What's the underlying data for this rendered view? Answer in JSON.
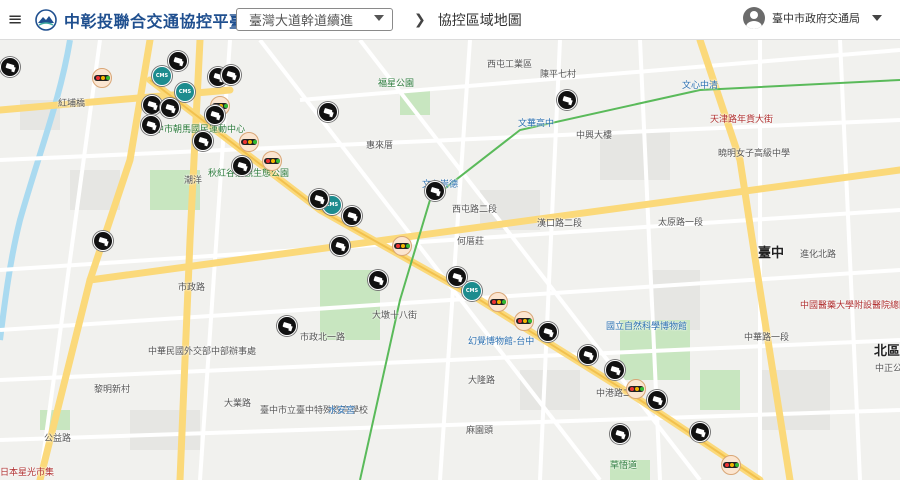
{
  "header": {
    "app_title": "中彰投聯合交通協控平臺",
    "route_select": "臺灣大道幹道續進",
    "breadcrumb": "協控區域地圖",
    "user_name": "臺中市政府交通局"
  },
  "icons": {
    "menu": "hamburger-icon",
    "logo": "mountain-logo",
    "user": "account-circle-icon",
    "chevron": "chevron-right-icon"
  },
  "marker_types": {
    "cam": "cctv-camera-icon",
    "tl": "traffic-signal-icon",
    "cms": "cms-sign-icon"
  },
  "marker_legend": {
    "cms_text": "CMS"
  },
  "colors": {
    "header_title": "#1f4f8f",
    "cms": "#1d8c8e",
    "camera": "#111111",
    "signal_bg": "#fbe5d0"
  },
  "map_labels": [
    {
      "text": "西屯工業區"
    },
    {
      "text": "陳平七村"
    },
    {
      "text": "福星公園"
    },
    {
      "text": "文華高中"
    },
    {
      "text": "惠來厝"
    },
    {
      "text": "文心崇德"
    },
    {
      "text": "天津路年貨大街"
    },
    {
      "text": "曉明女子高級中學"
    },
    {
      "text": "臺中市朝馬國民運動中心"
    },
    {
      "text": "秋紅谷景觀生態公園"
    },
    {
      "text": "潮洋"
    },
    {
      "text": "西屯路二段"
    },
    {
      "text": "何厝莊"
    },
    {
      "text": "漢口路二段"
    },
    {
      "text": "太原路一段"
    },
    {
      "text": "臺中"
    },
    {
      "text": "中國醫藥大學附設醫院總院"
    },
    {
      "text": "國立自然科學博物館"
    },
    {
      "text": "幻覺博物館-台中"
    },
    {
      "text": "中華民國外交部中部辦事處"
    },
    {
      "text": "黎明新村"
    },
    {
      "text": "臺中市立臺中特殊教育學校"
    },
    {
      "text": "水安宮"
    },
    {
      "text": "麻園頭"
    },
    {
      "text": "草悟道"
    },
    {
      "text": "日本星光市集"
    },
    {
      "text": "北區"
    },
    {
      "text": "中正公"
    },
    {
      "text": "紅埔橋"
    },
    {
      "text": "文心中清"
    },
    {
      "text": "市政路"
    },
    {
      "text": "市政北一路"
    },
    {
      "text": "大業路"
    },
    {
      "text": "公益路"
    },
    {
      "text": "中港路二段"
    },
    {
      "text": "進化北路"
    },
    {
      "text": "中華路一段"
    },
    {
      "text": "大墩十八街"
    },
    {
      "text": "大隆路"
    },
    {
      "text": "中興大樓"
    }
  ],
  "markers": [
    {
      "type": "cam"
    },
    {
      "type": "tl"
    },
    {
      "type": "cam"
    },
    {
      "type": "cms"
    },
    {
      "type": "cam"
    },
    {
      "type": "cms"
    },
    {
      "type": "cam"
    },
    {
      "type": "cam"
    },
    {
      "type": "tl"
    },
    {
      "type": "cam"
    },
    {
      "type": "cam"
    },
    {
      "type": "cam"
    },
    {
      "type": "tl"
    },
    {
      "type": "cam"
    },
    {
      "type": "tl"
    },
    {
      "type": "cam"
    },
    {
      "type": "cam"
    },
    {
      "type": "cms"
    },
    {
      "type": "cam"
    },
    {
      "type": "cam"
    },
    {
      "type": "tl"
    },
    {
      "type": "cam"
    },
    {
      "type": "cam"
    },
    {
      "type": "cms"
    },
    {
      "type": "tl"
    },
    {
      "type": "tl"
    },
    {
      "type": "cam"
    },
    {
      "type": "cam"
    },
    {
      "type": "cam"
    },
    {
      "type": "cam"
    },
    {
      "type": "tl"
    },
    {
      "type": "cam"
    },
    {
      "type": "cam"
    },
    {
      "type": "cam"
    },
    {
      "type": "tl"
    },
    {
      "type": "cam"
    },
    {
      "type": "cam"
    },
    {
      "type": "cam"
    },
    {
      "type": "cam"
    }
  ]
}
